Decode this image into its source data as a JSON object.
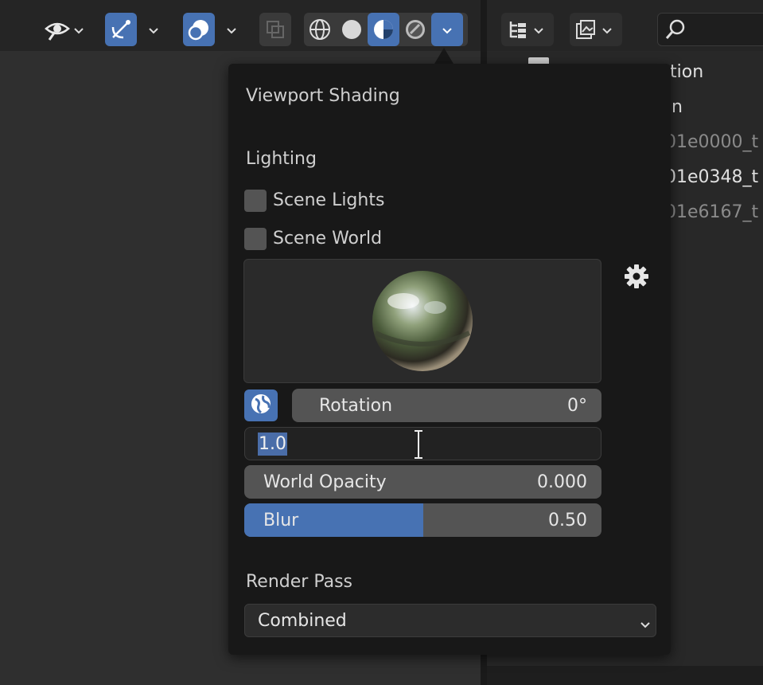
{
  "popover": {
    "title": "Viewport Shading",
    "lighting_label": "Lighting",
    "scene_lights_label": "Scene Lights",
    "scene_world_label": "Scene World",
    "rotation_label": "Rotation",
    "rotation_value": "0°",
    "strength_value": "1.0",
    "world_opacity_label": "World Opacity",
    "world_opacity_value": "0.000",
    "blur_label": "Blur",
    "blur_value": "0.50",
    "blur_fraction": 0.5,
    "render_pass_label": "Render Pass",
    "render_pass_value": "Combined"
  },
  "outliner": {
    "rows": [
      {
        "text": "tion",
        "dim": false
      },
      {
        "text": "n",
        "dim": false
      },
      {
        "text": "01e0000_t",
        "dim": true
      },
      {
        "text": "01e0348_t",
        "dim": false
      },
      {
        "text": "01e6167_t",
        "dim": true
      }
    ]
  },
  "colors": {
    "accent": "#4772b3",
    "popover_bg": "#181818",
    "field_bg": "#545454"
  },
  "icons": {
    "visibility": "eye-icon",
    "gizmo": "gizmo-icon",
    "overlays": "overlay-icon",
    "xray": "xray-icon",
    "wireframe": "wireframe-sphere-icon",
    "solid": "solid-sphere-icon",
    "material": "material-sphere-icon",
    "rendered": "rendered-sphere-icon",
    "settings": "gear-icon",
    "world": "world-icon",
    "search": "search-icon"
  }
}
